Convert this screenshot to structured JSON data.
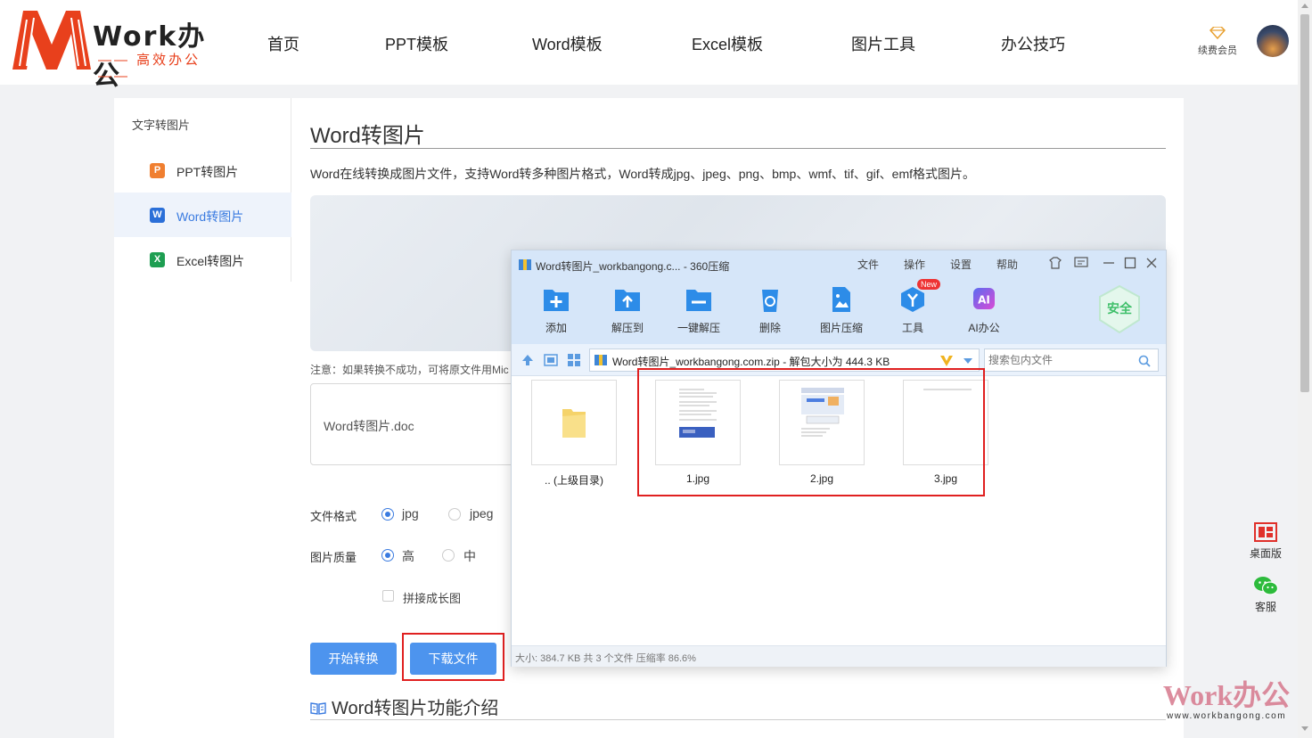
{
  "brand": {
    "word": "Work办公",
    "tagline": "—— 高效办公 ——"
  },
  "nav": [
    "首页",
    "PPT模板",
    "Word模板",
    "Excel模板",
    "图片工具",
    "办公技巧"
  ],
  "header": {
    "vip_label": "续费会员"
  },
  "sidebar": {
    "title": "文字转图片",
    "items": [
      {
        "icon": "P",
        "label": "PPT转图片",
        "color": "#f07f30"
      },
      {
        "icon": "W",
        "label": "Word转图片",
        "color": "#2b6fd8",
        "active": true
      },
      {
        "icon": "X",
        "label": "Excel转图片",
        "color": "#1e9e52"
      }
    ]
  },
  "main": {
    "title": "Word转图片",
    "description": "Word在线转换成图片文件，支持Word转多种图片格式，Word转成jpg、jpeg、png、bmp、wmf、tif、gif、emf格式图片。",
    "note": "注意：如果转换不成功，可将原文件用Mic",
    "file_name": "Word转图片.doc",
    "format_label": "文件格式",
    "formats": [
      "jpg",
      "jpeg"
    ],
    "quality_label": "图片质量",
    "qualities": [
      "高",
      "中"
    ],
    "merge_label": "拼接成长图",
    "convert_button": "开始转换",
    "download_button": "下载文件",
    "section_title": "Word转图片功能介绍"
  },
  "archive_window": {
    "title": "Word转图片_workbangong.c... - 360压缩",
    "menus": [
      "文件",
      "操作",
      "设置",
      "帮助"
    ],
    "tools": [
      "添加",
      "解压到",
      "一键解压",
      "删除",
      "图片压缩",
      "工具",
      "AI办公"
    ],
    "new_badge": "New",
    "safe_label": "安全",
    "path": "Word转图片_workbangong.com.zip - 解包大小为 444.3 KB",
    "search_placeholder": "搜索包内文件",
    "files": [
      ".. (上级目录)",
      "1.jpg",
      "2.jpg",
      "3.jpg"
    ],
    "status": "大小: 384.7 KB 共 3 个文件 压缩率 86.6%"
  },
  "float": {
    "desktop": "桌面版",
    "service": "客服"
  },
  "watermark": {
    "main": "Work办公",
    "url": "www.workbangong.com"
  },
  "colors": {
    "accent": "#4d94ee",
    "brand_red": "#e8401c",
    "highlight": "#e02020"
  }
}
